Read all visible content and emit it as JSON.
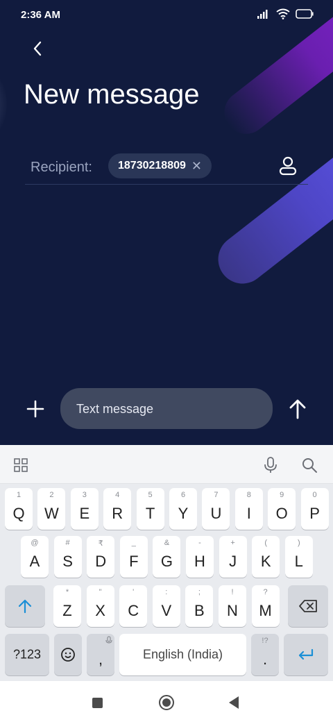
{
  "status_bar": {
    "time": "2:36 AM"
  },
  "header": {
    "title": "New message"
  },
  "recipient": {
    "label": "Recipient:",
    "chip": "18730218809"
  },
  "composer": {
    "placeholder": "Text message"
  },
  "keyboard": {
    "row1": [
      {
        "main": "Q",
        "hint": "1"
      },
      {
        "main": "W",
        "hint": "2"
      },
      {
        "main": "E",
        "hint": "3"
      },
      {
        "main": "R",
        "hint": "4"
      },
      {
        "main": "T",
        "hint": "5"
      },
      {
        "main": "Y",
        "hint": "6"
      },
      {
        "main": "U",
        "hint": "7"
      },
      {
        "main": "I",
        "hint": "8"
      },
      {
        "main": "O",
        "hint": "9"
      },
      {
        "main": "P",
        "hint": "0"
      }
    ],
    "row2": [
      {
        "main": "A",
        "hint": "@"
      },
      {
        "main": "S",
        "hint": "#"
      },
      {
        "main": "D",
        "hint": "₹"
      },
      {
        "main": "F",
        "hint": "_"
      },
      {
        "main": "G",
        "hint": "&"
      },
      {
        "main": "H",
        "hint": "-"
      },
      {
        "main": "J",
        "hint": "+"
      },
      {
        "main": "K",
        "hint": "("
      },
      {
        "main": "L",
        "hint": ")"
      }
    ],
    "row3": [
      {
        "main": "Z",
        "hint": "*"
      },
      {
        "main": "X",
        "hint": "\""
      },
      {
        "main": "C",
        "hint": "'"
      },
      {
        "main": "V",
        "hint": ":"
      },
      {
        "main": "B",
        "hint": ";"
      },
      {
        "main": "N",
        "hint": "!"
      },
      {
        "main": "M",
        "hint": "?"
      }
    ],
    "symbols_label": "?123",
    "comma": ",",
    "space_label": "English (India)",
    "period": ".",
    "period_hint": "!?"
  }
}
